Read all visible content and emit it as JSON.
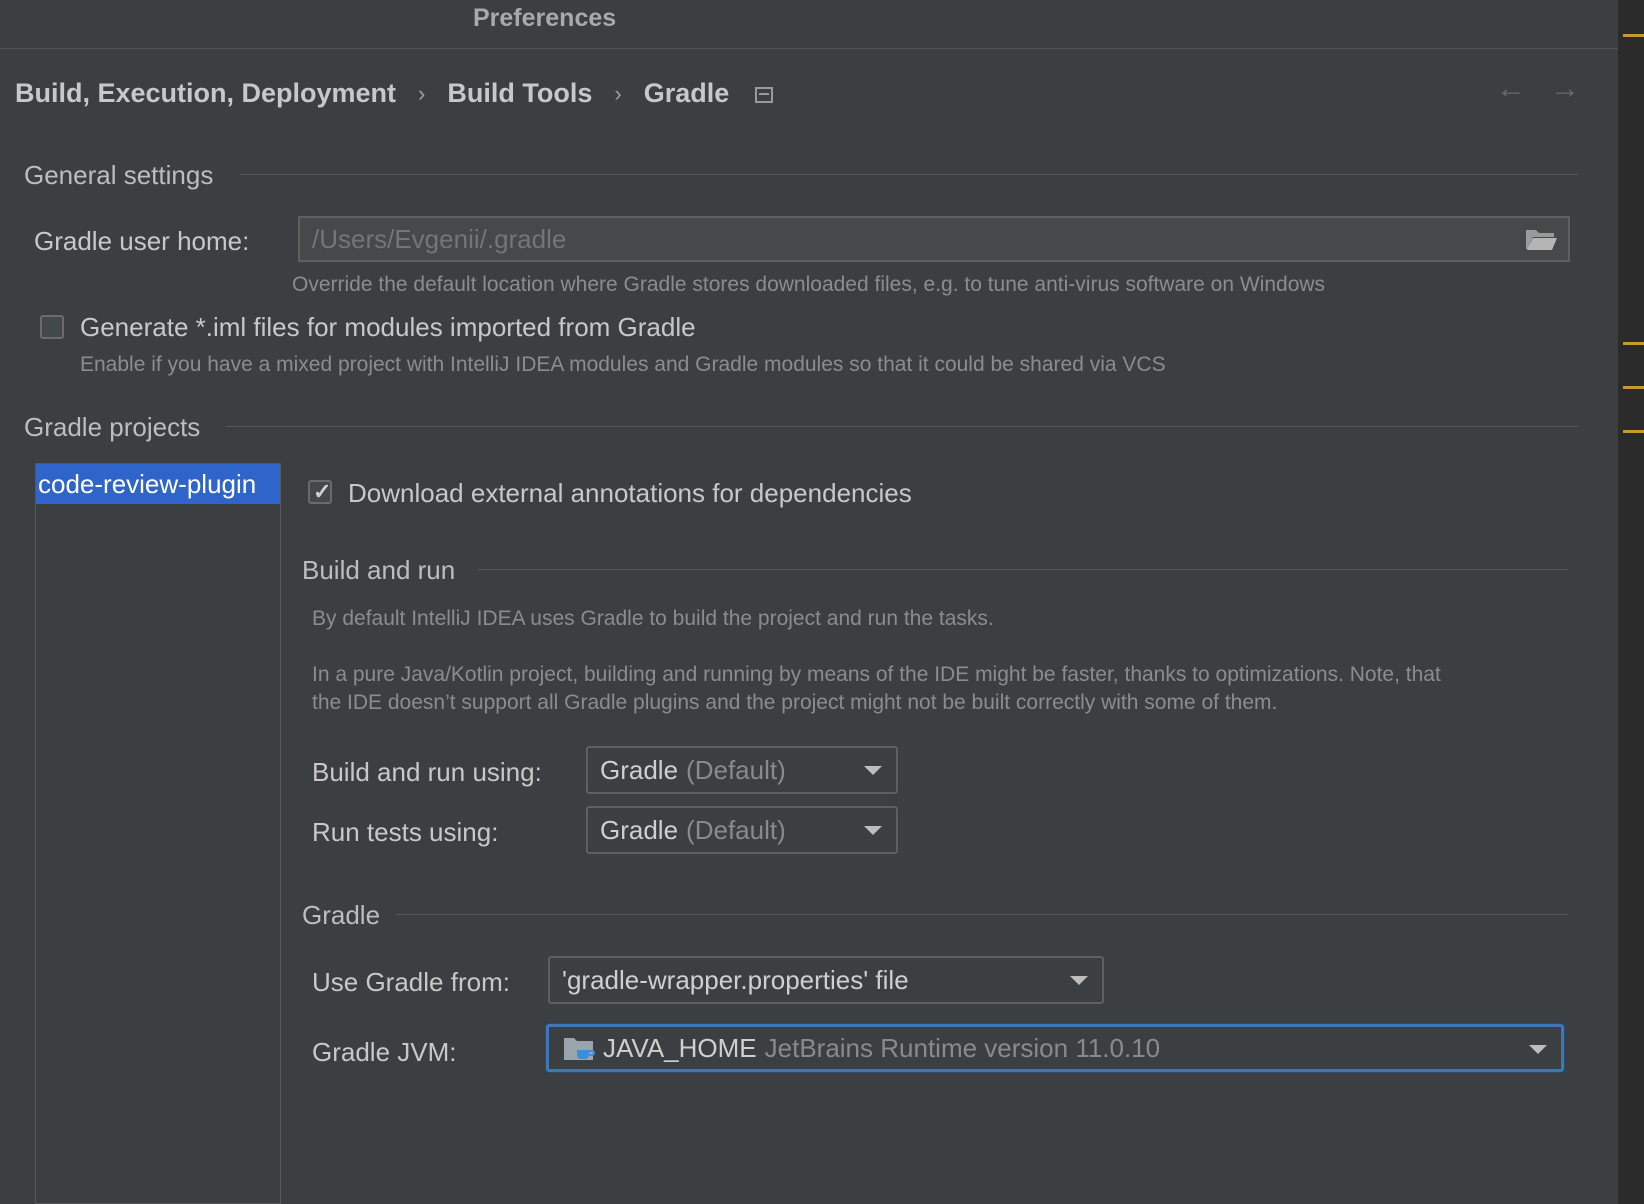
{
  "window": {
    "title": "Preferences"
  },
  "breadcrumb": {
    "items": [
      "Build, Execution, Deployment",
      "Build Tools",
      "Gradle"
    ],
    "separator": "›"
  },
  "nav": {
    "back_icon": "←",
    "forward_icon": "→"
  },
  "general": {
    "title": "General settings",
    "user_home_label": "Gradle user home:",
    "user_home_placeholder": "/Users/Evgenii/.gradle",
    "user_home_hint": "Override the default location where Gradle stores downloaded files, e.g. to tune anti-virus software on Windows",
    "iml_label": "Generate *.iml files for modules imported from Gradle",
    "iml_checked": false,
    "iml_hint": "Enable if you have a mixed project with IntelliJ IDEA modules and Gradle modules so that it could be shared via VCS"
  },
  "projects": {
    "title": "Gradle projects",
    "items": [
      "code-review-plugin"
    ],
    "download_annotations_label": "Download external annotations for dependencies",
    "download_annotations_checked": true
  },
  "build_and_run": {
    "title": "Build and run",
    "desc1": "By default IntelliJ IDEA uses Gradle to build the project and run the tasks.",
    "desc2_line1": "In a pure Java/Kotlin project, building and running by means of the IDE might be faster, thanks to optimizations. Note, that",
    "desc2_line2": "the IDE doesn’t support all Gradle plugins and the project might not be built correctly with some of them.",
    "build_using_label": "Build and run using:",
    "build_using_value": "Gradle",
    "build_using_suffix": "(Default)",
    "tests_using_label": "Run tests using:",
    "tests_using_value": "Gradle",
    "tests_using_suffix": "(Default)"
  },
  "gradle": {
    "title": "Gradle",
    "use_from_label": "Use Gradle from:",
    "use_from_value": "'gradle-wrapper.properties' file",
    "jvm_label": "Gradle JVM:",
    "jvm_value": "JAVA_HOME",
    "jvm_detail": "JetBrains Runtime version 11.0.10"
  },
  "colors": {
    "accent": "#2f65ca",
    "focus": "#3c77b8",
    "background": "#3c3f41"
  }
}
